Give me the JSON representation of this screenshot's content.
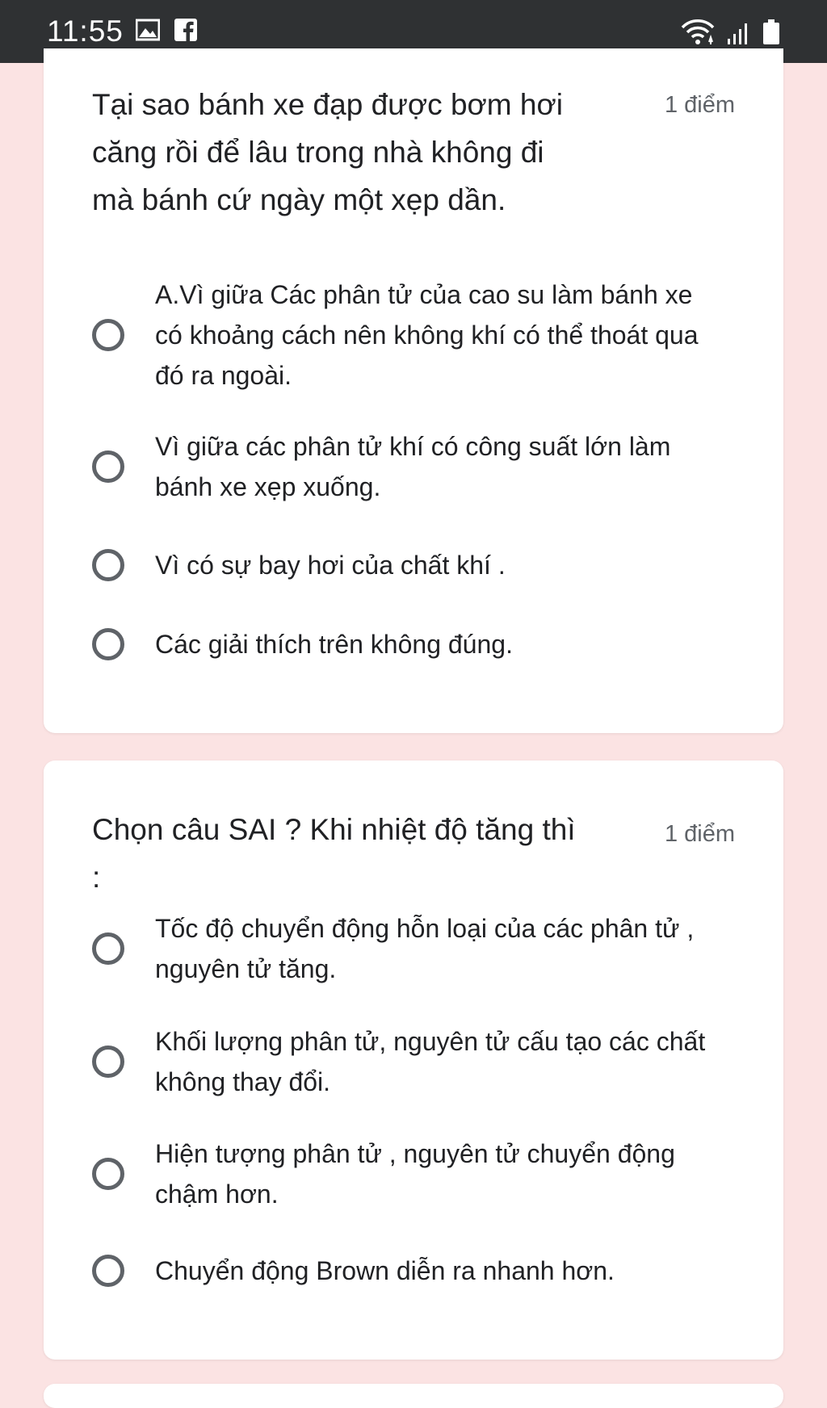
{
  "status_bar": {
    "time": "11:55",
    "icons_left": [
      "image-icon",
      "facebook-icon"
    ],
    "icons_right": [
      "wifi-icon",
      "signal-icon",
      "battery-icon"
    ]
  },
  "questions": [
    {
      "title": "Tại sao bánh xe đạp được bơm hơi căng rồi để lâu trong nhà không đi mà bánh cứ ngày một xẹp dần.",
      "points": "1 điểm",
      "options": [
        "A.Vì giữa Các phân tử của cao su làm bánh xe có khoảng cách nên không khí có thể thoát qua đó ra ngoài.",
        "Vì giữa các phân tử khí có công suất lớn làm bánh xe xẹp xuống.",
        "Vì có sự bay hơi của chất khí .",
        "Các giải thích trên không đúng."
      ]
    },
    {
      "title": "Chọn câu SAI ? Khi nhiệt độ tăng thì :",
      "points": "1 điểm",
      "options": [
        "Tốc độ chuyển động hỗn loại của các phân tử , nguyên tử tăng.",
        "Khối lượng phân tử, nguyên tử cấu tạo các chất không thay đổi.",
        "Hiện tượng phân tử , nguyên tử chuyển động chậm hơn.",
        "Chuyển động Brown diễn ra nhanh hơn."
      ]
    }
  ]
}
